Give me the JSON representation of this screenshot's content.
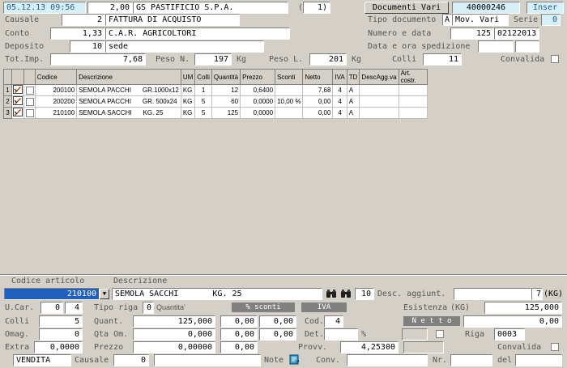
{
  "header": {
    "datetime": "05.12.13 09:56",
    "amount": "2,00",
    "supplier_name": "GS PASTIFICIO S.P.A.",
    "paren_value": "(",
    "paren_num": "1)",
    "doc_button": "Documenti Vari",
    "doc_number": "40000246",
    "mode": "Inser"
  },
  "row2": {
    "causale_label": "Causale",
    "causale_code": "2",
    "causale_desc": "FATTURA DI ACQUISTO",
    "tipo_doc_label": "Tipo documento",
    "tipo_doc_code": "A",
    "tipo_doc_desc": "Mov. Vari",
    "serie_label": "Serie",
    "serie_value": "0"
  },
  "row3": {
    "conto_label": "Conto",
    "conto_code": "1,33",
    "conto_desc": "C.A.R. AGRICOLTORI",
    "numdata_label": "Numero e data",
    "num_value": "125",
    "date_value": "02122013"
  },
  "row4": {
    "deposito_label": "Deposito",
    "deposito_code": "10",
    "deposito_desc": "sede",
    "spedizione_label": "Data e ora spedizione"
  },
  "row5": {
    "totimp_label": "Tot.Imp.",
    "totimp_value": "7,68",
    "peson_label": "Peso N.",
    "peson_value": "197",
    "peson_unit": "Kg",
    "pesol_label": "Peso L.",
    "pesol_value": "201",
    "pesol_unit": "Kg",
    "colli_label": "Colli",
    "colli_value": "11",
    "convalida_label": "Convalida"
  },
  "grid": {
    "columns": [
      "Codice",
      "Descrizione",
      "UM",
      "Colli",
      "Quantità",
      "Prezzo",
      "Sconti",
      "Netto",
      "IVA",
      "TD",
      "DescAgg.va",
      "Art. costr."
    ],
    "rows": [
      {
        "n": "1",
        "codice": "200100",
        "descr": "SEMOLA PACCHI",
        "fmt": "GR.1000x12",
        "um": "KG",
        "colli": "1",
        "qta": "12",
        "prezzo": "0,6400",
        "sconti": "",
        "netto": "7,68",
        "iva": "4",
        "td": "A",
        "descagg": "",
        "artcostr": ""
      },
      {
        "n": "2",
        "codice": "200200",
        "descr": "SEMOLA PACCHI",
        "fmt": "GR. 500x24",
        "um": "KG",
        "colli": "5",
        "qta": "60",
        "prezzo": "0,0000",
        "sconti": "10,00 %",
        "netto": "0,00",
        "iva": "4",
        "td": "A",
        "descagg": "",
        "artcostr": ""
      },
      {
        "n": "3",
        "codice": "210100",
        "descr": "SEMOLA SACCHI",
        "fmt": "KG. 25",
        "um": "KG",
        "colli": "5",
        "qta": "125",
        "prezzo": "0,0000",
        "sconti": "",
        "netto": "0,00",
        "iva": "4",
        "td": "A",
        "descagg": "",
        "artcostr": ""
      }
    ]
  },
  "detail": {
    "codice_label": "Codice articolo",
    "descr_label": "Descrizione",
    "codice_value": "210100",
    "descr_value": "SEMOLA SACCHI       KG. 25",
    "small_num": "10",
    "desc_agg_label": "Desc. aggiunt.",
    "um_num": "7",
    "um_unit": "(KG)",
    "ucar_label": "U.Car.",
    "ucar_value": "0",
    "ucar_value2": "4",
    "tipo_riga_label": "Tipo riga",
    "tipo_riga_value": "0",
    "tipo_riga_desc": "Quantita'",
    "sconti_hdr": "% sconti",
    "iva_hdr": "IVA",
    "esistenza_label": "Esistenza",
    "esistenza_unit": "(KG)",
    "esistenza_value": "125,000",
    "colli_label": "Colli",
    "colli_value": "5",
    "quant_label": "Quant.",
    "quant_value": "125,000",
    "sc1": "0,00",
    "sc2": "0,00",
    "cod_label": "Cod.",
    "cod_value": "4",
    "netto_hdr": "N e t t o",
    "netto_value": "0,00",
    "omag_label": "Omag.",
    "omag_value": "0",
    "qtaom_label": "Qta Om.",
    "qtaom_value": "0,000",
    "sc3": "0,00",
    "sc4": "0,00",
    "det_label": "Det.",
    "det_pct": "%",
    "riga_label": "Riga",
    "riga_value": "0003",
    "extra_label": "Extra",
    "extra_value": "0,0000",
    "prezzo_label": "Prezzo",
    "prezzo_value": "0,00000",
    "sc5": "0,00",
    "provv_label": "Provv.",
    "provv_value": "4,25300",
    "convalida_label": "Convalida",
    "vendita_value": "VENDITA",
    "causale_label": "Causale",
    "causale_value": "0",
    "note_label": "Note",
    "conv_label": "Conv.",
    "nr_label": "Nr.",
    "del_label": "del"
  }
}
